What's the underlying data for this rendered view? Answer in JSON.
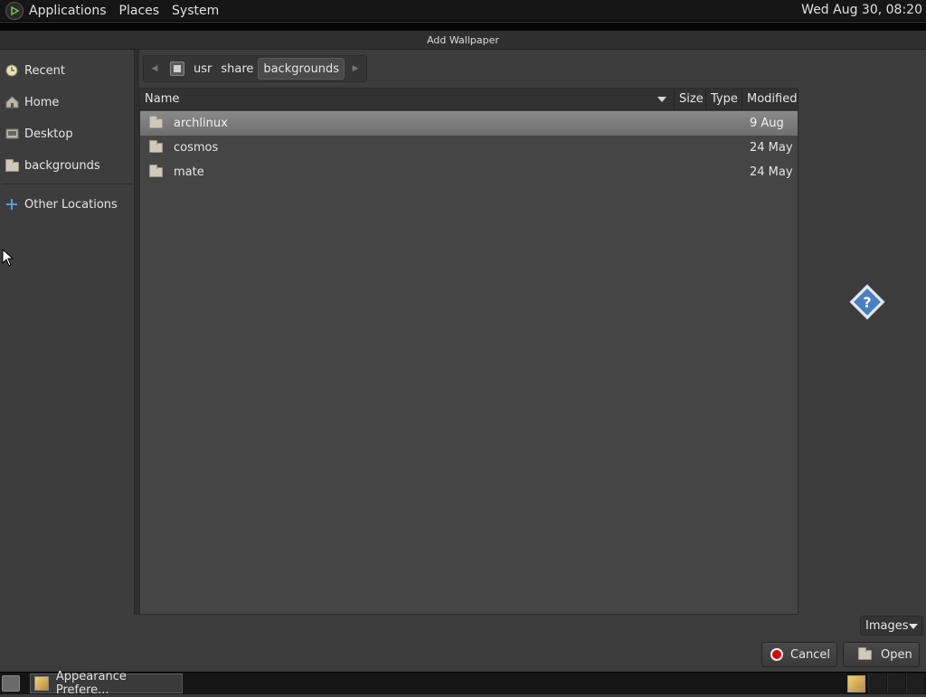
{
  "top_panel": {
    "menus": [
      "Applications",
      "Places",
      "System"
    ],
    "clock": "Wed Aug 30, 08:20"
  },
  "dialog": {
    "title": "Add Wallpaper"
  },
  "sidebar": {
    "items": [
      {
        "label": "Recent",
        "icon": "recent-icon"
      },
      {
        "label": "Home",
        "icon": "home-icon"
      },
      {
        "label": "Desktop",
        "icon": "desktop-icon"
      },
      {
        "label": "backgrounds",
        "icon": "folder-icon"
      },
      {
        "label": "Other Locations",
        "icon": "plus-icon"
      }
    ]
  },
  "pathbar": {
    "crumbs": [
      "usr",
      "share",
      "backgrounds"
    ]
  },
  "filelist": {
    "columns": {
      "name": "Name",
      "size": "Size",
      "type": "Type",
      "modified": "Modified"
    },
    "rows": [
      {
        "name": "archlinux",
        "modified": "9 Aug"
      },
      {
        "name": "cosmos",
        "modified": "24 May"
      },
      {
        "name": "mate",
        "modified": "24 May"
      }
    ]
  },
  "filter": {
    "selected": "Images"
  },
  "buttons": {
    "cancel": "Cancel",
    "open": "Open"
  },
  "taskbar": {
    "task_label": "Appearance Prefere..."
  },
  "colors": {
    "selection": "#7c7c7c",
    "help_icon": "#4a7fc1",
    "cancel_red": "#dd0000"
  }
}
